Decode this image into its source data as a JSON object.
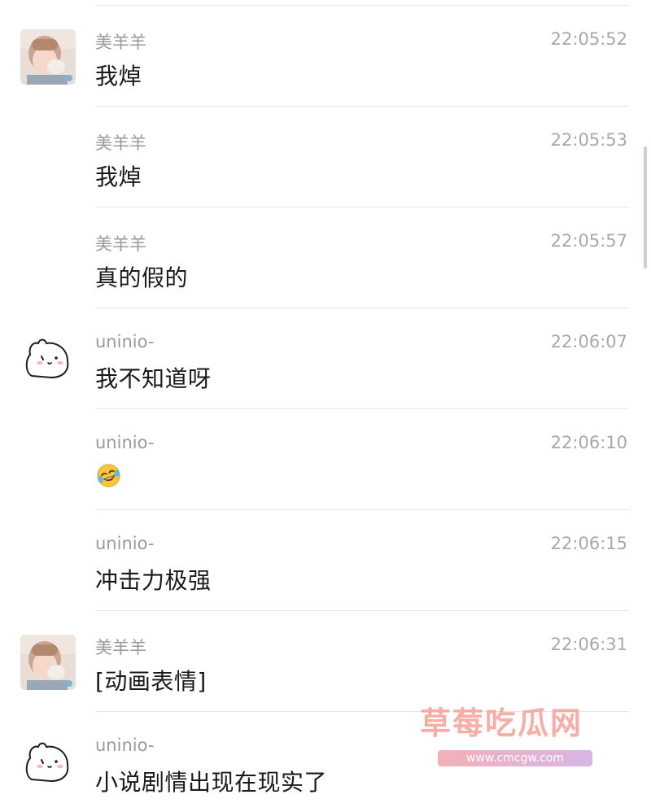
{
  "messages": [
    {
      "sender": "美羊羊",
      "time": "22:05:52",
      "text": "我焯",
      "avatar": "girl-photo"
    },
    {
      "sender": "美羊羊",
      "time": "22:05:53",
      "text": "我焯",
      "avatar": null
    },
    {
      "sender": "美羊羊",
      "time": "22:05:57",
      "text": "真的假的",
      "avatar": null
    },
    {
      "sender": "uninio-",
      "time": "22:06:07",
      "text": "我不知道呀",
      "avatar": "white-bunny-doodle"
    },
    {
      "sender": "uninio-",
      "time": "22:06:10",
      "emoji": "laughing-crying-face",
      "avatar": null
    },
    {
      "sender": "uninio-",
      "time": "22:06:15",
      "text": "冲击力极强",
      "avatar": null
    },
    {
      "sender": "美羊羊",
      "time": "22:06:31",
      "text": "[动画表情]",
      "avatar": "girl-photo"
    },
    {
      "sender": "uninio-",
      "time": "",
      "text": "小说剧情出现在现实了",
      "avatar": "white-bunny-doodle"
    }
  ],
  "watermark": {
    "title": "草莓吃瓜网",
    "url": "www.cmcgw.com"
  },
  "colors": {
    "name": "#9a9a9a",
    "time": "#a8a8a8",
    "text": "#1a1a1a",
    "divider": "#e6e6e6"
  }
}
